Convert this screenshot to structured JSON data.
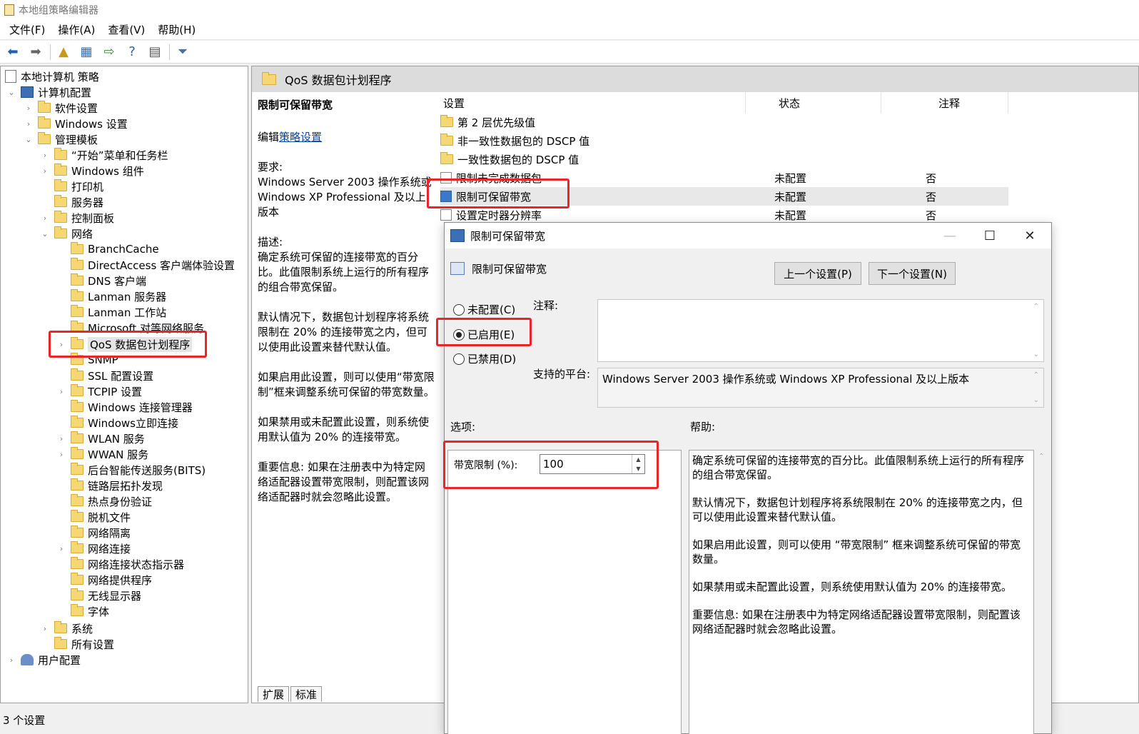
{
  "window": {
    "title": "本地组策略编辑器"
  },
  "menu": [
    "文件(F)",
    "操作(A)",
    "查看(V)",
    "帮助(H)"
  ],
  "toolbar": {
    "buttons": [
      "back-icon",
      "forward-icon",
      "up-folder-icon",
      "show-hide-tree-icon",
      "export-list-icon",
      "help-icon",
      "properties-icon",
      "filter-icon"
    ]
  },
  "tree": {
    "root": "本地计算机 策略",
    "computer_config": "计算机配置",
    "software_settings": "软件设置",
    "windows_settings": "Windows 设置",
    "admin_templates": "管理模板",
    "start_menu": "“开始”菜单和任务栏",
    "windows_components": "Windows 组件",
    "printers": "打印机",
    "servers": "服务器",
    "control_panel": "控制面板",
    "network": "网络",
    "network_children": [
      "BranchCache",
      "DirectAccess 客户端体验设置",
      "DNS 客户端",
      "Lanman 服务器",
      "Lanman 工作站",
      "Microsoft 对等网络服务",
      "QoS 数据包计划程序",
      "SNMP",
      "SSL 配置设置",
      "TCPIP 设置",
      "Windows 连接管理器",
      "Windows立即连接",
      "WLAN 服务",
      "WWAN 服务",
      "后台智能传送服务(BITS)",
      "链路层拓扑发现",
      "热点身份验证",
      "脱机文件",
      "网络隔离",
      "网络连接",
      "网络连接状态指示器",
      "网络提供程序",
      "无线显示器",
      "字体"
    ],
    "system": "系统",
    "all_settings": "所有设置",
    "user_config": "用户配置"
  },
  "right": {
    "header": "QoS 数据包计划程序",
    "desc_title": "限制可保留带宽",
    "desc_edit_prefix": "编辑",
    "desc_edit_link": "策略设置",
    "desc_req_label": "要求:",
    "desc_req": "Windows Server 2003 操作系统或 Windows XP Professional 及以上版本",
    "desc_label": "描述:",
    "desc_p1": "确定系统可保留的连接带宽的百分比。此值限制系统上运行的所有程序的组合带宽保留。",
    "desc_p2": "默认情况下，数据包计划程序将系统限制在 20% 的连接带宽之内，但可以使用此设置来替代默认值。",
    "desc_p3": "如果启用此设置，则可以使用“带宽限制”框来调整系统可保留的带宽数量。",
    "desc_p4": "如果禁用或未配置此设置，则系统使用默认值为 20% 的连接带宽。",
    "desc_p5": "重要信息: 如果在注册表中为特定网络适配器设置带宽限制，则配置该网络适配器时就会忽略此设置。",
    "columns": [
      "设置",
      "状态",
      "注释"
    ],
    "rows": [
      {
        "name": "第 2 层优先级值",
        "status": "",
        "note": "",
        "type": "folder"
      },
      {
        "name": "非一致性数据包的 DSCP 值",
        "status": "",
        "note": "",
        "type": "folder"
      },
      {
        "name": "一致性数据包的 DSCP 值",
        "status": "",
        "note": "",
        "type": "folder"
      },
      {
        "name": "限制未完成数据包",
        "status": "未配置",
        "note": "否",
        "type": "setting"
      },
      {
        "name": "限制可保留带宽",
        "status": "未配置",
        "note": "否",
        "type": "setting"
      },
      {
        "name": "设置定时器分辨率",
        "status": "未配置",
        "note": "否",
        "type": "setting"
      }
    ],
    "tabs": [
      "扩展",
      "标准"
    ]
  },
  "status_bar": "3 个设置",
  "dialog": {
    "title": "限制可保留带宽",
    "heading": "限制可保留带宽",
    "prev_button": "上一个设置(P)",
    "next_button": "下一个设置(N)",
    "radio_not_configured": "未配置(C)",
    "radio_enabled": "已启用(E)",
    "radio_disabled": "已禁用(D)",
    "selected_option": "已启用(E)",
    "comment_label": "注释:",
    "comment_value": "",
    "platform_label": "支持的平台:",
    "platform_value": "Windows Server 2003 操作系统或 Windows XP Professional 及以上版本",
    "options_label": "选项:",
    "help_label": "帮助:",
    "bandwidth_label": "带宽限制 (%):",
    "bandwidth_value": "100",
    "help_p1": "确定系统可保留的连接带宽的百分比。此值限制系统上运行的所有程序的组合带宽保留。",
    "help_p2": "默认情况下，数据包计划程序将系统限制在 20% 的连接带宽之内，但可以使用此设置来替代默认值。",
    "help_p3": "如果启用此设置，则可以使用 “带宽限制” 框来调整系统可保留的带宽数量。",
    "help_p4": "如果禁用或未配置此设置，则系统使用默认值为 20% 的连接带宽。",
    "help_p5": "重要信息: 如果在注册表中为特定网络适配器设置带宽限制，则配置该网络适配器时就会忽略此设置。"
  },
  "colors": {
    "highlight_box": "#e8262a",
    "link": "#0645ad",
    "header_bg": "#dcdcdc"
  }
}
